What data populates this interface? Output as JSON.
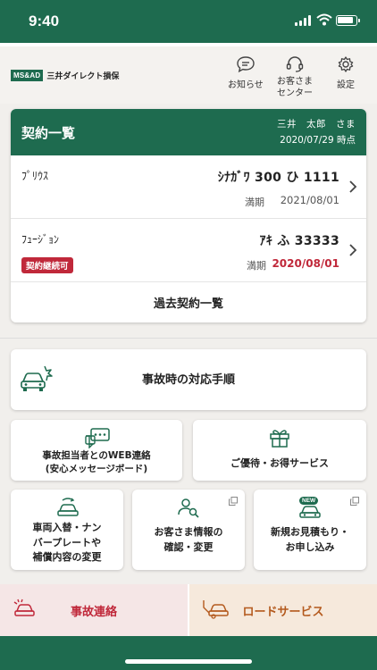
{
  "status_bar": {
    "time": "9:40"
  },
  "header": {
    "logo_mark": "MS&AD",
    "logo_text": "三井ダイレクト損保",
    "notice_label": "お知らせ",
    "center_label_1": "お客さま",
    "center_label_2": "センター",
    "settings_label": "設定"
  },
  "contracts": {
    "title": "契約一覧",
    "user_name": "三井　太郎　さま",
    "as_of": "2020/07/29 時点",
    "items": [
      {
        "car": "ﾌﾟﾘｳｽ",
        "plate": "ｼﾅｶﾞﾜ 300 ひ 1111",
        "expiry_label": "満期",
        "expiry_date": "2021/08/01",
        "badge": ""
      },
      {
        "car": "ﾌｭｰｼﾞｮﾝ",
        "plate": "ｱｷ ふ 33333",
        "expiry_label": "満期",
        "expiry_date": "2020/08/01",
        "badge": "契約継続可"
      }
    ],
    "past_label": "過去契約一覧"
  },
  "menu": {
    "accident_flow": "事故時の対応手順",
    "web_contact_1": "事故担当者とのWEB連絡",
    "web_contact_2": "(安心メッセージボード)",
    "benefits": "ご優待・お得サービス",
    "vehicle_change_1": "車両入替・ナン",
    "vehicle_change_2": "バープレートや",
    "vehicle_change_3": "補償内容の変更",
    "customer_info_1": "お客さま情報の",
    "customer_info_2": "確認・変更",
    "new_quote_1": "新規お見積もり・",
    "new_quote_2": "お申し込み",
    "new_badge": "NEW"
  },
  "bottom": {
    "accident_report": "事故連絡",
    "road_service": "ロードサービス"
  },
  "colors": {
    "brand_green": "#1e6b4f",
    "alert_red": "#c0283a",
    "road_orange": "#b45a1e"
  }
}
